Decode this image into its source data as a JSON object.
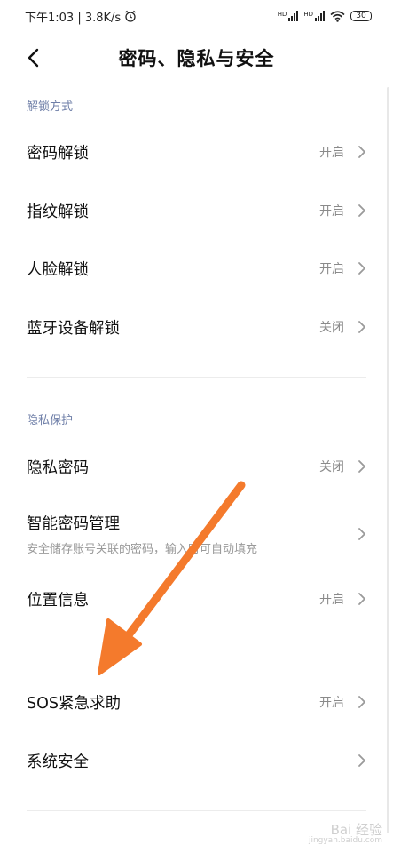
{
  "status_bar": {
    "time_speed": "下午1:03 | 3.8K/s",
    "signal1_label": "HD",
    "signal2_label": "HD",
    "battery": "30"
  },
  "header": {
    "title": "密码、隐私与安全"
  },
  "sections": [
    {
      "label": "解锁方式",
      "items": [
        {
          "title": "密码解锁",
          "value": "开启"
        },
        {
          "title": "指纹解锁",
          "value": "开启"
        },
        {
          "title": "人脸解锁",
          "value": "开启"
        },
        {
          "title": "蓝牙设备解锁",
          "value": "关闭"
        }
      ]
    },
    {
      "label": "隐私保护",
      "items": [
        {
          "title": "隐私密码",
          "value": "关闭"
        },
        {
          "title": "智能密码管理",
          "subtitle": "安全储存账号关联的密码，输入时可自动填充"
        },
        {
          "title": "位置信息",
          "value": "开启"
        }
      ]
    },
    {
      "items": [
        {
          "title": "SOS紧急求助",
          "value": "开启"
        },
        {
          "title": "系统安全"
        }
      ]
    }
  ],
  "watermark": {
    "brand": "Bai 经验",
    "url": "jingyan.baidu.com"
  },
  "colors": {
    "section_label": "#6f7fa8",
    "arrow": "#f47a2c"
  }
}
